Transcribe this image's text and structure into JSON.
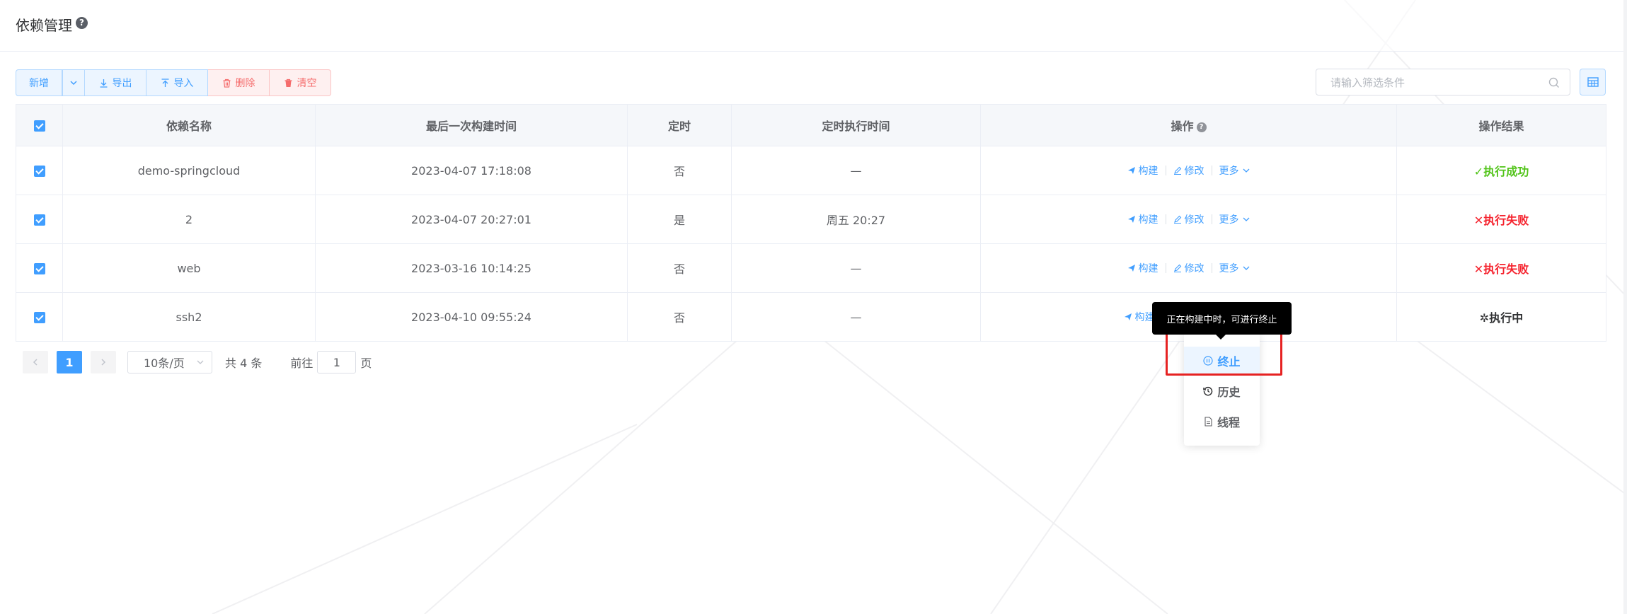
{
  "header": {
    "title": "依赖管理"
  },
  "toolbar": {
    "add_label": "新增",
    "export_label": "导出",
    "import_label": "导入",
    "delete_label": "删除",
    "clear_label": "清空"
  },
  "search": {
    "placeholder": "请输入筛选条件"
  },
  "table": {
    "columns": [
      "依赖名称",
      "最后一次构建时间",
      "定时",
      "定时执行时间",
      "操作",
      "操作结果"
    ],
    "action_labels": {
      "build": "构建",
      "edit": "修改",
      "more": "更多"
    },
    "rows": [
      {
        "name": "demo-springcloud",
        "last_build": "2023-04-07 17:18:08",
        "scheduled": "否",
        "schedule_time": "—",
        "result": "执行成功",
        "result_status": "success"
      },
      {
        "name": "2",
        "last_build": "2023-04-07 20:27:01",
        "scheduled": "是",
        "schedule_time": "周五 20:27",
        "result": "执行失败",
        "result_status": "fail"
      },
      {
        "name": "web",
        "last_build": "2023-03-16 10:14:25",
        "scheduled": "否",
        "schedule_time": "—",
        "result": "执行失败",
        "result_status": "fail"
      },
      {
        "name": "ssh2",
        "last_build": "2023-04-10 09:55:24",
        "scheduled": "否",
        "schedule_time": "—",
        "result": "执行中",
        "result_status": "running"
      }
    ]
  },
  "pagination": {
    "current_page": "1",
    "page_size": "10条/页",
    "total": "共 4 条",
    "goto_prefix": "前往",
    "goto_value": "1",
    "goto_suffix": "页"
  },
  "dropdown": {
    "items": [
      "终止",
      "历史",
      "线程"
    ]
  },
  "tooltip": {
    "text": "正在构建中时，可进行终止"
  },
  "colors": {
    "primary": "#409eff",
    "danger": "#f56c6c",
    "success": "#52c41a",
    "fail": "#f5222d",
    "highlight": "#e62222"
  }
}
